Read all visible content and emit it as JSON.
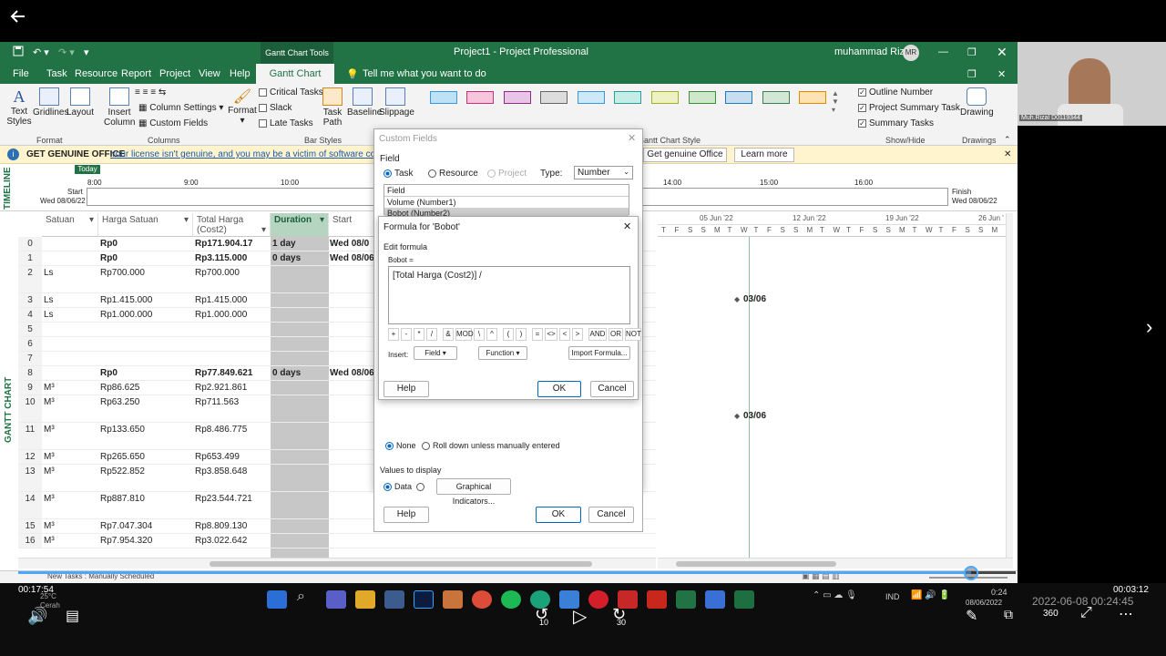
{
  "window": {
    "context_tab": "Gantt Chart Tools",
    "title": "Project1 - Project Professional",
    "user": "muhammad Rizal",
    "user_initials": "MR"
  },
  "ribbon_tabs": [
    "File",
    "Task",
    "Resource",
    "Report",
    "Project",
    "View",
    "Help",
    "Gantt Chart Format"
  ],
  "tell_me": "Tell me what you want to do",
  "ribbon": {
    "format_group": {
      "buttons": [
        "Text Styles",
        "Gridlines",
        "Layout"
      ],
      "label": "Format"
    },
    "columns_group": {
      "insert": "Insert Column",
      "column_settings": "Column Settings",
      "custom_fields": "Custom Fields",
      "label": "Columns"
    },
    "format_btn": "Format",
    "bar_checks": [
      "Critical Tasks",
      "Slack",
      "Late Tasks"
    ],
    "task_path": "Task Path",
    "baseline": "Baseline",
    "slippage": "Slippage",
    "bar_styles_label": "Bar Styles",
    "gantt_style_label": "Gantt Chart Style",
    "show_hide": {
      "items": [
        "Outline Number",
        "Project Summary Task",
        "Summary Tasks"
      ],
      "label": "Show/Hide"
    },
    "drawing": {
      "button": "Drawing",
      "label": "Drawings"
    }
  },
  "message_bar": {
    "title": "GET GENUINE OFFICE",
    "text": "Your license isn't genuine, and you may be a victim of software counterfeiting.",
    "btn_genuine": "Get genuine Office",
    "btn_learn": "Learn more"
  },
  "timeline": {
    "label": "TIMELINE",
    "today": "Today",
    "start_label": "Start",
    "start_date": "Wed 08/06/22",
    "finish_label": "Finish",
    "finish_date": "Wed 08/06/22",
    "ticks": [
      "8:00",
      "9:00",
      "10:00",
      "14:00",
      "15:00",
      "16:00"
    ]
  },
  "gantt_label": "GANTT CHART",
  "grid": {
    "columns": [
      "Satuan",
      "Harga Satuan",
      "Total Harga (Cost2)",
      "Duration",
      "Start"
    ],
    "rows": [
      {
        "id": "0",
        "satuan": "",
        "harga": "Rp0",
        "total": "Rp171.904.17",
        "duration": "1 day",
        "start": "Wed 08/0",
        "bold": true
      },
      {
        "id": "1",
        "satuan": "",
        "harga": "Rp0",
        "total": "Rp3.115.000",
        "duration": "0 days",
        "start": "Wed 08/06",
        "bold": true
      },
      {
        "id": "2",
        "satuan": "Ls",
        "harga": "Rp700.000",
        "total": "Rp700.000",
        "duration": "",
        "start": "",
        "bold": false
      },
      {
        "id": "3",
        "satuan": "Ls",
        "harga": "Rp1.415.000",
        "total": "Rp1.415.000",
        "duration": "",
        "start": "",
        "bold": false
      },
      {
        "id": "4",
        "satuan": "Ls",
        "harga": "Rp1.000.000",
        "total": "Rp1.000.000",
        "duration": "",
        "start": "",
        "bold": false
      },
      {
        "id": "5",
        "satuan": "",
        "harga": "",
        "total": "",
        "duration": "",
        "start": "",
        "bold": false
      },
      {
        "id": "6",
        "satuan": "",
        "harga": "",
        "total": "",
        "duration": "",
        "start": "",
        "bold": false
      },
      {
        "id": "7",
        "satuan": "",
        "harga": "",
        "total": "",
        "duration": "",
        "start": "",
        "bold": false
      },
      {
        "id": "8",
        "satuan": "",
        "harga": "Rp0",
        "total": "Rp77.849.621",
        "duration": "0 days",
        "start": "Wed 08/06",
        "bold": true
      },
      {
        "id": "9",
        "satuan": "M³",
        "harga": "Rp86.625",
        "total": "Rp2.921.861",
        "duration": "",
        "start": "",
        "bold": false
      },
      {
        "id": "10",
        "satuan": "M³",
        "harga": "Rp63.250",
        "total": "Rp711.563",
        "duration": "",
        "start": "",
        "bold": false
      },
      {
        "id": "11",
        "satuan": "M³",
        "harga": "Rp133.650",
        "total": "Rp8.486.775",
        "duration": "",
        "start": "",
        "bold": false
      },
      {
        "id": "12",
        "satuan": "M³",
        "harga": "Rp265.650",
        "total": "Rp653.499",
        "duration": "",
        "start": "",
        "bold": false
      },
      {
        "id": "13",
        "satuan": "M³",
        "harga": "Rp522.852",
        "total": "Rp3.858.648",
        "duration": "",
        "start": "",
        "bold": false
      },
      {
        "id": "14",
        "satuan": "M³",
        "harga": "Rp887.810",
        "total": "Rp23.544.721",
        "duration": "",
        "start": "",
        "bold": false
      },
      {
        "id": "15",
        "satuan": "M³",
        "harga": "Rp7.047.304",
        "total": "Rp8.809.130",
        "duration": "",
        "start": "",
        "bold": false
      },
      {
        "id": "16",
        "satuan": "M³",
        "harga": "Rp7.954.320",
        "total": "Rp3.022.642",
        "duration": "",
        "start": "",
        "bold": false
      }
    ]
  },
  "chart": {
    "weeks": [
      "05 Jun '22",
      "12 Jun '22",
      "19 Jun '22",
      "26 Jun '"
    ],
    "days": [
      "T",
      "F",
      "S",
      "S",
      "M",
      "T",
      "W",
      "T",
      "F",
      "S",
      "S",
      "M",
      "T",
      "W",
      "T",
      "F",
      "S",
      "S",
      "M",
      "T",
      "W",
      "T",
      "F",
      "S",
      "S",
      "M"
    ],
    "milestone_labels": [
      "03/06",
      "03/06"
    ]
  },
  "custom_fields_dialog": {
    "title": "Custom Fields",
    "field_label": "Field",
    "task": "Task",
    "resource": "Resource",
    "project": "Project",
    "type_label": "Type:",
    "type_value": "Number",
    "list": [
      "Field",
      "Volume (Number1)",
      "Bobot (Number2)"
    ],
    "rollup_none": "None",
    "rollup_text": "Roll down unless manually entered",
    "values_label": "Values to display",
    "data": "Data",
    "graphical": "Graphical Indicators...",
    "help": "Help",
    "ok": "OK",
    "cancel": "Cancel"
  },
  "formula_dialog": {
    "title": "Formula for 'Bobot'",
    "edit_label": "Edit formula",
    "field_eq": "Bobot =",
    "formula": "[Total Harga (Cost2)] /",
    "operators": [
      "+",
      "-",
      "*",
      "/",
      "&",
      "MOD",
      "\\",
      "^",
      "(",
      ")",
      "=",
      "<>",
      "<",
      ">",
      "AND",
      "OR",
      "NOT"
    ],
    "insert_label": "Insert:",
    "field_btn": "Field",
    "function_btn": "Function",
    "import_btn": "Import Formula...",
    "help": "Help",
    "ok": "OK",
    "cancel": "Cancel"
  },
  "status_bar": {
    "text": "New Tasks : Manually Scheduled"
  },
  "webcam": {
    "name": "Muh.Rizal D0119344"
  },
  "player": {
    "elapsed": "00:17:54",
    "remaining": "00:03:12",
    "weather_temp": "25°C",
    "weather_text": "Cerah",
    "skip_back": "10",
    "skip_fwd": "30",
    "clock_time": "0:24",
    "clock_date": "08/06/2022",
    "lang": "IND",
    "timestamp": "2022-06-08 00:24:45",
    "progress_fraction": 0.955
  }
}
